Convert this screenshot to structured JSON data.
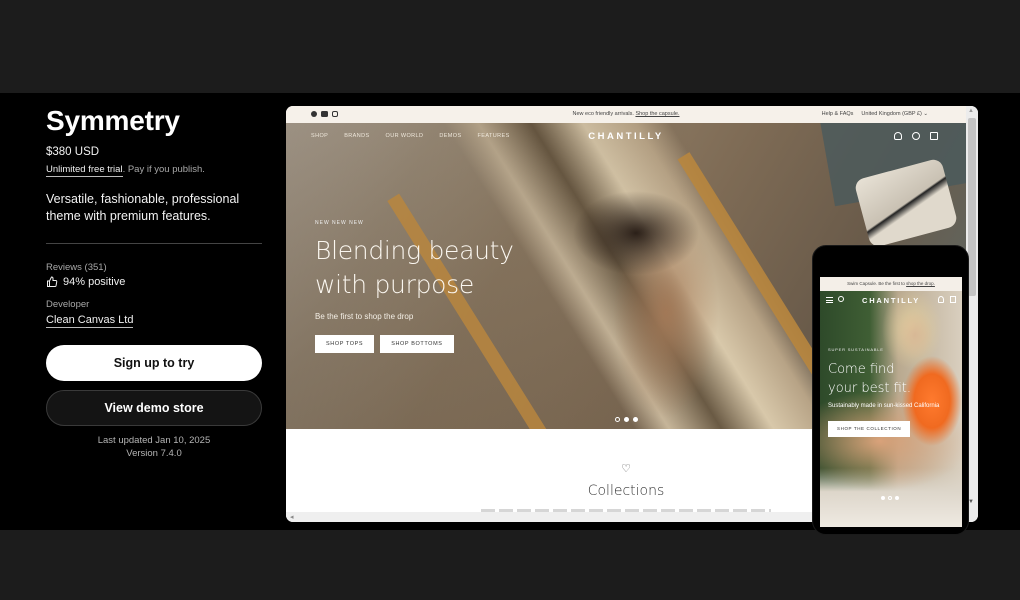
{
  "theme": {
    "title": "Symmetry",
    "price": "$380 USD",
    "trial_link": "Unlimited free trial",
    "trial_note": ". Pay if you publish.",
    "description": "Versatile, fashionable, professional theme with premium features.",
    "reviews_label": "Reviews (351)",
    "reviews_rating": "94% positive",
    "reviews_icon": "thumbs-up-icon",
    "developer_label": "Developer",
    "developer_name": "Clean Canvas Ltd",
    "primary_button": "Sign up to try",
    "secondary_button": "View demo store",
    "last_updated": "Last updated Jan 10, 2025",
    "version": "Version 7.4.0"
  },
  "desktop_preview": {
    "announcement": {
      "social_icons": [
        "facebook-icon",
        "youtube-icon",
        "instagram-icon"
      ],
      "message": "New eco friendly arrivals.",
      "message_link": "Shop the capsule.",
      "help": "Help & FAQs",
      "locale": "United Kingdom (GBP £)"
    },
    "nav": [
      "SHOP",
      "BRANDS",
      "OUR WORLD",
      "DEMOS",
      "FEATURES"
    ],
    "brand": "CHANTILLY",
    "header_icons": [
      "account-icon",
      "search-icon",
      "cart-icon"
    ],
    "hero": {
      "eyebrow": "NEW NEW NEW",
      "headline_line1": "Blending beauty",
      "headline_line2": "with purpose",
      "subheading": "Be the first to shop the drop",
      "buttons": [
        "SHOP TOPS",
        "SHOP BOTTOMS"
      ],
      "slides": 3,
      "active_slide": 1
    },
    "section_icon": "heart-icon",
    "section_title": "Collections"
  },
  "mobile_preview": {
    "announcement": "Swim Capsule. Be the first to",
    "announcement_link": "shop the drop.",
    "brand": "CHANTILLY",
    "hero": {
      "eyebrow": "SUPER SUSTAINABLE",
      "headline_line1": "Come find",
      "headline_line2": "your best fit.",
      "subheading": "Sustainably made in sun-kissed California",
      "button": "SHOP THE COLLECTION",
      "slides": 3,
      "active_slide": 2
    }
  }
}
